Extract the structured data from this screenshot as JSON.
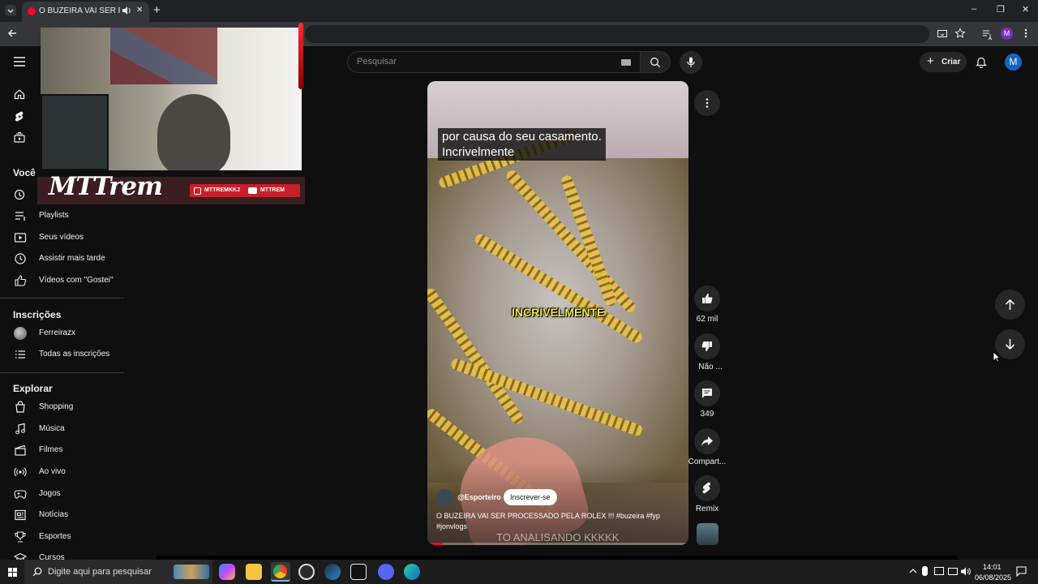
{
  "browser": {
    "tab_title": "O BUZEIRA VAI SER PROCE",
    "profile_initial": "M",
    "window_min": "–",
    "window_max": "❐",
    "window_close": "✕",
    "new_tab": "+"
  },
  "overlay": {
    "brand": "MTTrem",
    "handle_ig": "MTTREMKKJ",
    "handle_yt": "MTTREM"
  },
  "header": {
    "search_placeholder": "Pesquisar",
    "create_label": "Criar",
    "avatar_initial": "M"
  },
  "sidebar": {
    "you_heading": "Você",
    "you_items": [
      {
        "label": "Playlists",
        "icon": "playlist-icon"
      },
      {
        "label": "Seus vídeos",
        "icon": "video-icon"
      },
      {
        "label": "Assistir mais tarde",
        "icon": "clock-icon"
      },
      {
        "label": "Vídeos com \"Gostei\"",
        "icon": "thumbs-up-icon"
      }
    ],
    "subs_heading": "Inscrições",
    "subs_items": [
      {
        "label": "Ferreirazx",
        "icon": "channel-avatar"
      },
      {
        "label": "Todas as inscrições",
        "icon": "list-icon"
      }
    ],
    "explore_heading": "Explorar",
    "explore_items": [
      {
        "label": "Shopping",
        "icon": "shopping-bag-icon"
      },
      {
        "label": "Música",
        "icon": "music-icon"
      },
      {
        "label": "Filmes",
        "icon": "clapper-icon"
      },
      {
        "label": "Ao vivo",
        "icon": "live-icon"
      },
      {
        "label": "Jogos",
        "icon": "gamepad-icon"
      },
      {
        "label": "Notícias",
        "icon": "news-icon"
      },
      {
        "label": "Esportes",
        "icon": "trophy-icon"
      },
      {
        "label": "Cursos",
        "icon": "graduation-icon"
      }
    ]
  },
  "video": {
    "caption_line1": "por causa do seu casamento.",
    "caption_line2": "Incrivelmente",
    "center_caption": "INCRIVELMENTE",
    "channel": "@Esporteiro",
    "subscribe_label": "Inscrever-se",
    "title_line1": "O BUZEIRA VAI SER PROCESSADO PELA ROLEX !!! #buzeira #fyp",
    "title_line2": "#jonvlogs",
    "bottom_text": "TO ANALISANDO KKKKK",
    "progress": 0.06
  },
  "actions": {
    "likes": "62 mil",
    "dislike": "Não ...",
    "comments": "349",
    "share": "Compart...",
    "remix": "Remix"
  },
  "taskbar": {
    "search_placeholder": "Digite aqui para pesquisar",
    "time": "14:01",
    "date": "06/08/2025"
  },
  "colors": {
    "yt_red": "#ff0033",
    "bg": "#0f0f0f",
    "caption_yellow": "#f5e94a",
    "avatar_blue": "#1565c0"
  }
}
